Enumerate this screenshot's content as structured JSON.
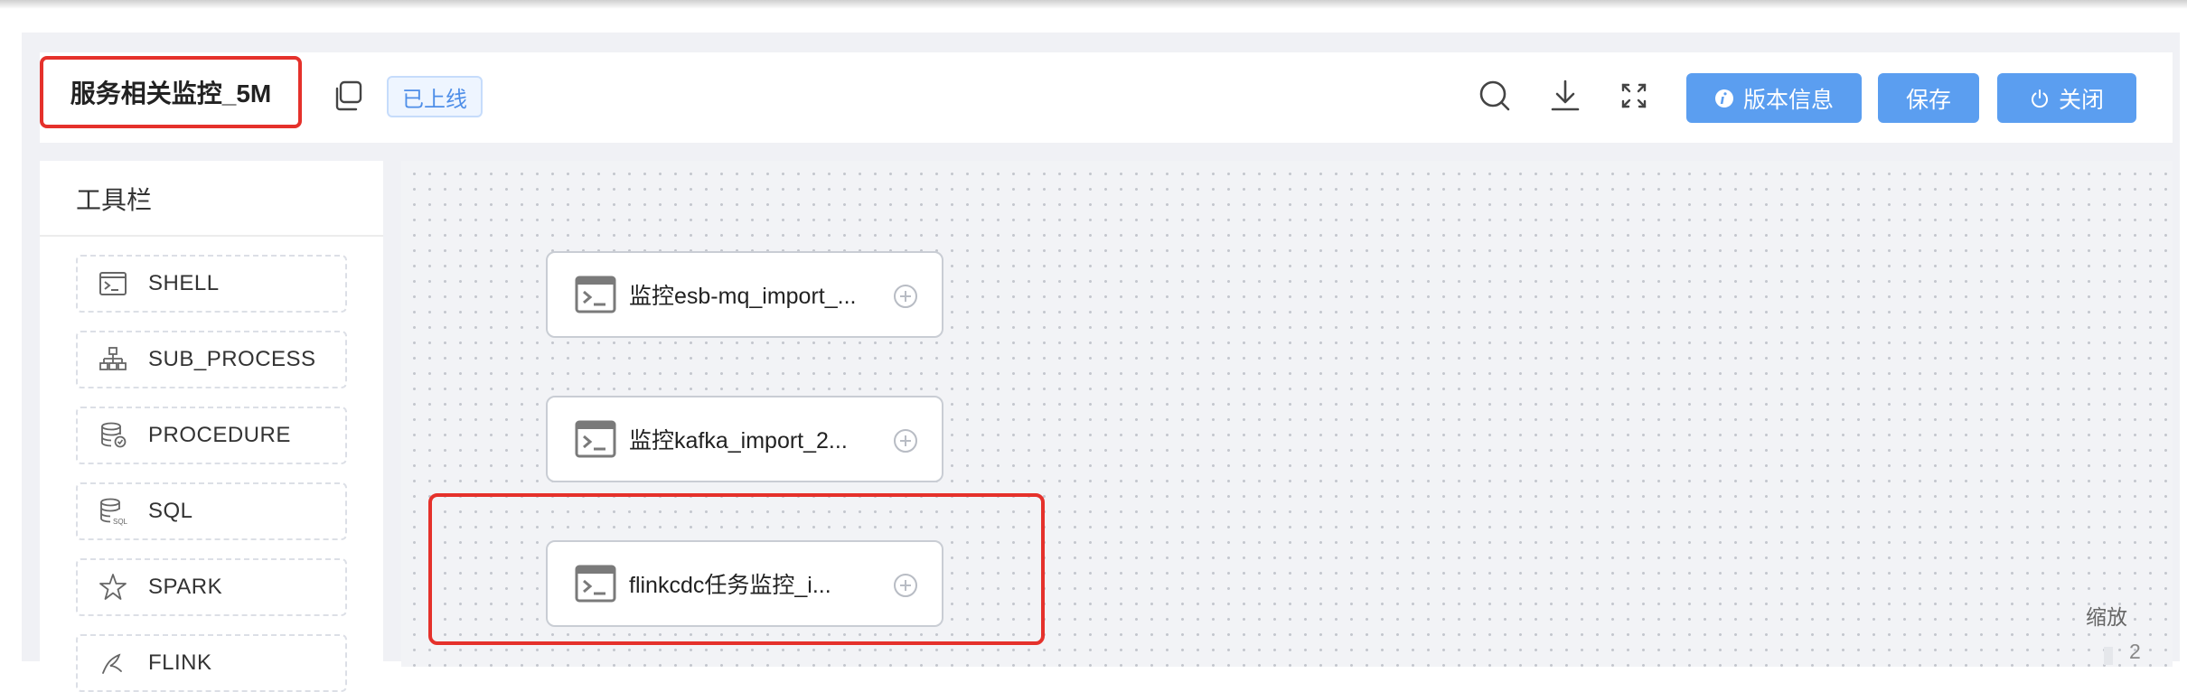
{
  "header": {
    "title": "服务相关监控_5M",
    "status_badge": "已上线",
    "buttons": {
      "version_info": "版本信息",
      "save": "保存",
      "close": "关闭"
    },
    "icons": [
      "search-icon",
      "download-icon",
      "fullscreen-icon",
      "copy-icon",
      "info-icon",
      "power-icon"
    ]
  },
  "toolbar": {
    "title": "工具栏",
    "items": [
      {
        "label": "SHELL",
        "icon": "shell-icon"
      },
      {
        "label": "SUB_PROCESS",
        "icon": "sub-process-icon"
      },
      {
        "label": "PROCEDURE",
        "icon": "procedure-icon"
      },
      {
        "label": "SQL",
        "icon": "sql-icon"
      },
      {
        "label": "SPARK",
        "icon": "spark-icon"
      },
      {
        "label": "FLINK",
        "icon": "flink-icon"
      }
    ]
  },
  "canvas": {
    "nodes": [
      {
        "label": "监控esb-mq_import_...",
        "icon": "shell-icon"
      },
      {
        "label": "监控kafka_import_2...",
        "icon": "shell-icon"
      },
      {
        "label": "flinkcdc任务监控_i...",
        "icon": "shell-icon"
      }
    ],
    "zoom_label": "缩放",
    "zoom_value": "2"
  },
  "colors": {
    "primary": "#5b9ef0",
    "highlight": "#e5312b",
    "badge_text": "#4e8ee8",
    "canvas_bg": "#f2f3f6"
  }
}
